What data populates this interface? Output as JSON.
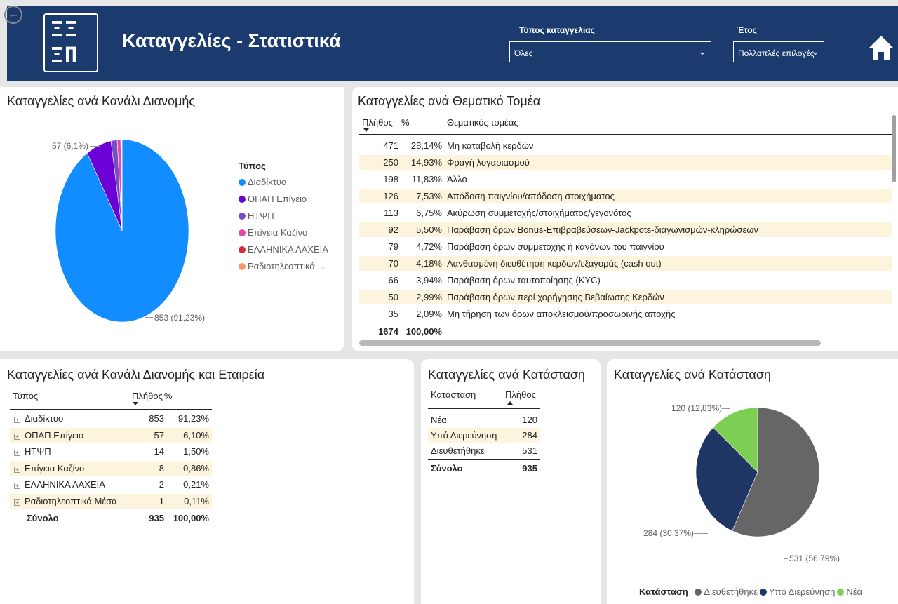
{
  "header": {
    "title": "Καταγγελίες - Στατιστικά",
    "filter1_label": "Τύπος καταγγελίας",
    "filter1_value": "Όλες",
    "filter2_label": "Έτος",
    "filter2_value": "Πολλαπλές επιλογές",
    "logo_top": "ΞΞ",
    "logo_bottom": "ΞΠ"
  },
  "channel_pie": {
    "title": "Καταγγελίες ανά Κανάλι Διανομής",
    "label_small": "57 (6,1%)",
    "label_big": "853 (91,23%)",
    "legend_title": "Τύπος",
    "legend": [
      "Διαδίκτυο",
      "ΟΠΑΠ Επίγειο",
      "ΗΤΨΠ",
      "Επίγεια Καζίνο",
      "ΕΛΛΗΝΙΚΑ ΛΑΧΕΙΑ",
      "Ραδιοτηλεοπτικά ..."
    ],
    "colors": [
      "#118dff",
      "#6b00d7",
      "#744ec2",
      "#e645ab",
      "#d82c3c",
      "#fe9666"
    ]
  },
  "sector_table": {
    "title": "Καταγγελίες ανά Θεματικό Τομέα",
    "col_count": "Πλήθος",
    "col_pct": "%",
    "col_sector": "Θεματικός τομέας",
    "rows": [
      {
        "count": "471",
        "pct": "28,14%",
        "sector": "Μη καταβολή κερδών"
      },
      {
        "count": "250",
        "pct": "14,93%",
        "sector": "Φραγή λογαριασμού"
      },
      {
        "count": "198",
        "pct": "11,83%",
        "sector": "Άλλο"
      },
      {
        "count": "126",
        "pct": "7,53%",
        "sector": "Απόδοση παιγνίου/απόδοση στοιχήματος"
      },
      {
        "count": "113",
        "pct": "6,75%",
        "sector": "Ακύρωση συμμετοχής/στοιχήματος/γεγονότος"
      },
      {
        "count": "92",
        "pct": "5,50%",
        "sector": "Παράβαση όρων Bonus-Επιβραβεύσεων-Jackpots-διαγωνισμών-κληρώσεων"
      },
      {
        "count": "79",
        "pct": "4,72%",
        "sector": "Παράβαση όρων συμμετοχής ή κανόνων του παιγνίου"
      },
      {
        "count": "70",
        "pct": "4,18%",
        "sector": "Λανθασμένη διευθέτηση κερδών/εξαγοράς (cash out)"
      },
      {
        "count": "66",
        "pct": "3,94%",
        "sector": "Παράβαση όρων ταυτοποίησης (KYC)"
      },
      {
        "count": "50",
        "pct": "2,99%",
        "sector": "Παράβαση όρων περί χορήγησης Βεβαίωσης Κερδών"
      },
      {
        "count": "35",
        "pct": "2,09%",
        "sector": "Μη τήρηση των όρων αποκλεισμού/προσωρινής αποχής"
      }
    ],
    "total_count": "1674",
    "total_pct": "100,00%"
  },
  "channel_table": {
    "title": "Καταγγελίες ανά Κανάλι Διανομής και Εταιρεία",
    "col_type": "Τύπος",
    "col_count": "Πλήθος",
    "col_pct": "%",
    "rows": [
      {
        "type": "Διαδίκτυο",
        "count": "853",
        "pct": "91,23%"
      },
      {
        "type": "ΟΠΑΠ Επίγειο",
        "count": "57",
        "pct": "6,10%"
      },
      {
        "type": "ΗΤΨΠ",
        "count": "14",
        "pct": "1,50%"
      },
      {
        "type": "Επίγεια Καζίνο",
        "count": "8",
        "pct": "0,86%"
      },
      {
        "type": "ΕΛΛΗΝΙΚΑ ΛΑΧΕΙΑ",
        "count": "2",
        "pct": "0,21%"
      },
      {
        "type": "Ραδιοτηλεοπτικά Μέσα",
        "count": "1",
        "pct": "0,11%"
      }
    ],
    "total_label": "Σύνολο",
    "total_count": "935",
    "total_pct": "100,00%"
  },
  "status_table": {
    "title": "Καταγγελίες ανά Κατάσταση",
    "col_status": "Κατάσταση",
    "col_count": "Πλήθος",
    "rows": [
      {
        "status": "Νέα",
        "count": "120"
      },
      {
        "status": "Υπό Διερεύνηση",
        "count": "284"
      },
      {
        "status": "Διευθετήθηκε",
        "count": "531"
      }
    ],
    "total_label": "Σύνολο",
    "total_count": "935"
  },
  "status_pie": {
    "title": "Καταγγελίες ανά Κατάσταση",
    "label_new": "120 (12,83%)",
    "label_inv": "284 (30,37%)",
    "label_done": "531 (56,79%)",
    "legend_title": "Κατάσταση",
    "legend": [
      "Διευθετήθηκε",
      "Υπό Διερεύνηση",
      "Νέα"
    ],
    "colors": [
      "#666666",
      "#1f3563",
      "#7ccf52"
    ]
  },
  "chart_data": [
    {
      "type": "pie",
      "title": "Καταγγελίες ανά Κανάλι Διανομής",
      "categories": [
        "Διαδίκτυο",
        "ΟΠΑΠ Επίγειο",
        "ΗΤΨΠ",
        "Επίγεια Καζίνο",
        "ΕΛΛΗΝΙΚΑ ΛΑΧΕΙΑ",
        "Ραδιοτηλεοπτικά ..."
      ],
      "values": [
        853,
        57,
        14,
        8,
        2,
        1
      ]
    },
    {
      "type": "pie",
      "title": "Καταγγελίες ανά Κατάσταση",
      "categories": [
        "Διευθετήθηκε",
        "Υπό Διερεύνηση",
        "Νέα"
      ],
      "values": [
        531,
        284,
        120
      ]
    }
  ]
}
